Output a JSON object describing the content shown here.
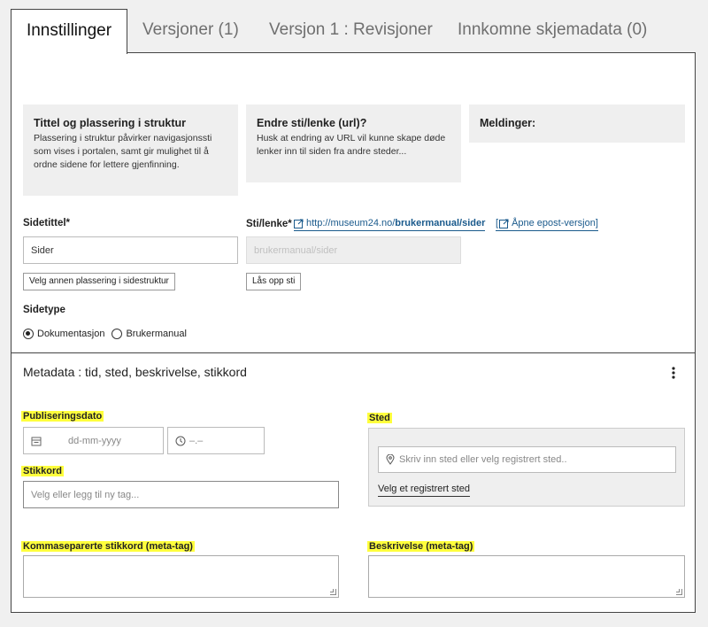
{
  "tabs": [
    {
      "label": "Innstillinger"
    },
    {
      "label": "Versjoner (1)"
    },
    {
      "label": "Versjon 1 : Revisjoner"
    },
    {
      "label": "Innkomne skjemadata (0)"
    }
  ],
  "info_boxes": [
    {
      "title": "Tittel og plassering i struktur",
      "text": "Plassering i struktur påvirker navigasjonssti som vises i portalen, samt gir mulighet til å ordne sidene for lettere gjenfinning."
    },
    {
      "title": "Endre sti/lenke (url)?",
      "text": "Husk at endring av URL vil kunne skape døde lenker inn til siden fra andre steder..."
    },
    {
      "title": "Meldinger:",
      "text": ""
    }
  ],
  "page_title": {
    "label": "Sidetittel*",
    "value": "Sider",
    "button": "Velg annen plassering i sidestruktur"
  },
  "path": {
    "label": "Sti/lenke*",
    "url_prefix": "http://museum24.no/",
    "url_bold": "brukermanual/sider",
    "open_email_version": "Åpne epost-versjon]",
    "open_email_bracket": "[",
    "value": "brukermanual/sider",
    "unlock_button": "Lås opp sti"
  },
  "page_type": {
    "label": "Sidetype",
    "options": [
      {
        "label": "Dokumentasjon",
        "checked": true
      },
      {
        "label": "Brukermanual",
        "checked": false
      }
    ]
  },
  "metadata": {
    "heading": "Metadata : tid, sted, beskrivelse, stikkord",
    "publish_date_label": "Publiseringsdato",
    "date_placeholder": "dd-mm-yyyy",
    "time_placeholder": "–.–",
    "place_label": "Sted",
    "place_placeholder": "Skriv inn sted eller velg registrert sted..",
    "choose_place_link": "Velg et registrert sted",
    "tags_label": "Stikkord",
    "tags_placeholder": "Velg eller legg til ny tag...",
    "meta_tags_label": "Kommaseparerte stikkord (meta-tag)",
    "description_label": "Beskrivelse (meta-tag)"
  },
  "colors": {
    "highlight": "#ffff3c",
    "link": "#1a5a8c",
    "info_box_bg": "#efefef",
    "page_bg": "#f0f0f0"
  }
}
